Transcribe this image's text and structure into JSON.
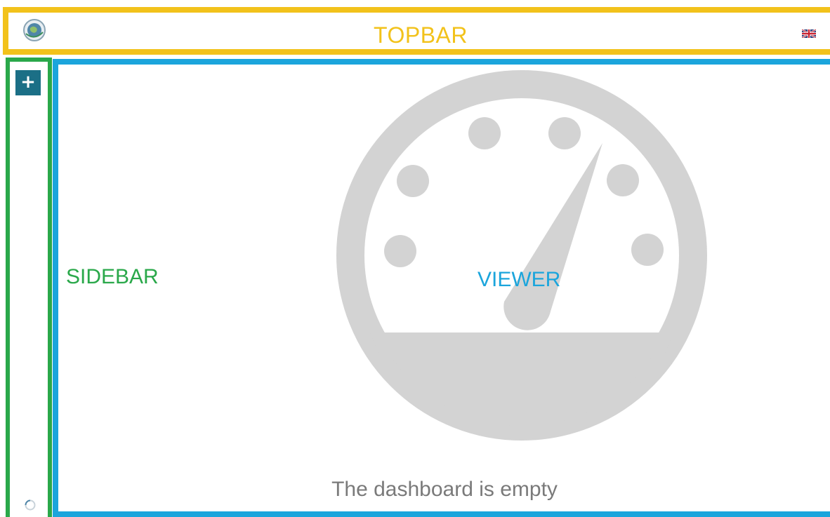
{
  "regions": {
    "topbar_label": "TOPBAR",
    "sidebar_label": "SIDEBAR",
    "viewer_label": "VIEWER"
  },
  "sidebar": {
    "add_button_label": "+"
  },
  "viewer": {
    "empty_message": "The dashboard is empty"
  },
  "icons": {
    "logo": "globe-logo-icon",
    "language": "uk-flag-icon",
    "add": "plus-icon",
    "loader": "loading-spinner-icon",
    "empty_state": "speedometer-gauge-icon"
  },
  "colors": {
    "topbar_border": "#f2c21b",
    "sidebar_border": "#2aa84a",
    "viewer_border": "#1ba5dc",
    "add_button_bg": "#1b6f86",
    "gauge_gray": "#d3d3d3",
    "empty_text": "#7a7a7a"
  }
}
